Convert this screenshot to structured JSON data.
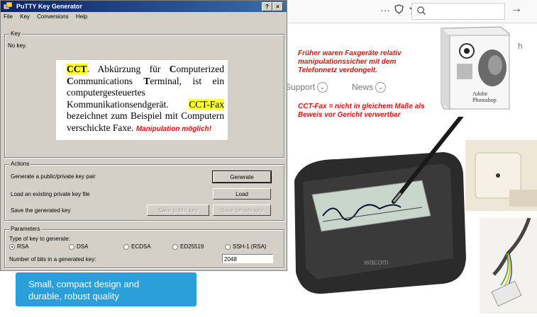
{
  "window": {
    "title": "PuTTY Key Generator",
    "help_btn": "?",
    "close_btn": "×",
    "menu": [
      "File",
      "Key",
      "Conversions",
      "Help"
    ]
  },
  "key_group": {
    "legend": "Key",
    "status": "No key."
  },
  "definition": {
    "term": "CCT",
    "text_parts": ". Abkürzung für ",
    "c1": "C",
    "w1": "omputerized ",
    "c2": "C",
    "w2": "ommunications ",
    "c3": "T",
    "w3": "erminal, ist ein computergesteuertes Kommunikationsendgerät. ",
    "fax": "CCT-Fax",
    "rest": " bezeichnet zum Beispiel mit Computern verschickte Faxe. ",
    "warning": "Manipulation möglich!"
  },
  "actions": {
    "legend": "Actions",
    "generate_label": "Generate a public/private key pair",
    "generate_btn": "Generate",
    "load_label": "Load an existing private key file",
    "load_btn": "Load",
    "save_label": "Save the generated key",
    "save_public_btn": "Save public key",
    "save_private_btn": "Save private key"
  },
  "parameters": {
    "legend": "Parameters",
    "type_label": "Type of key to generate:",
    "types": [
      "RSA",
      "DSA",
      "ECDSA",
      "ED25519",
      "SSH-1 (RSA)"
    ],
    "selected_type": "RSA",
    "bits_label": "Number of bits in a generated key:",
    "bits_value": "2048"
  },
  "background": {
    "toolbar_icons": [
      "more-icon",
      "shield-icon",
      "star-icon",
      "search-icon",
      "arrow-right-icon"
    ],
    "dots": "···",
    "arrow": "→",
    "nav_support": "Support",
    "nav_news": "News",
    "partial_h": "h",
    "note1": "Früher waren Faxgeräte relativ manipulationssicher mit dem Telefonnetz verdongelt.",
    "note2": "CCT-Fax = nicht in gleichem Maße als Beweis vor Gericht verwertbar",
    "promo_line1": "Small, compact design and",
    "promo_line2": "durable, robust quality",
    "product_label": "Adobe Photoshop",
    "tablet_brand": "wacom",
    "signature": "Grace Lee"
  }
}
